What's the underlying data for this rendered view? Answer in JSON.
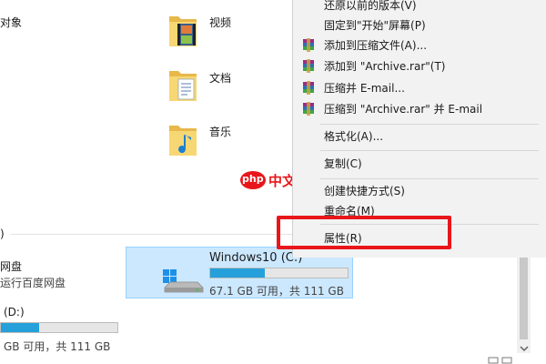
{
  "folders": [
    {
      "label": "视频",
      "icon": "video-folder-icon"
    },
    {
      "label": "文档",
      "icon": "documents-folder-icon"
    },
    {
      "label": "音乐",
      "icon": "music-folder-icon"
    }
  ],
  "left_clipped": {
    "objects_label": "对象",
    "section_caret": ")",
    "netdisk_name": "网盘",
    "netdisk_sub": "运行百度网盘",
    "drive_d_name": "(D:)",
    "drive_d_space": "GB 可用，共 111 GB",
    "drive_d_used_fraction": 0.33
  },
  "drive_c": {
    "name": "Windows10 (C:)",
    "space": "67.1 GB 可用，共 111 GB",
    "used_fraction": 0.4
  },
  "context_menu": {
    "items": [
      {
        "label": "还原以前的版本(V)",
        "icon": ""
      },
      {
        "label": "固定到\"开始\"屏幕(P)",
        "icon": ""
      },
      {
        "label": "添加到压缩文件(A)...",
        "icon": "winrar-icon"
      },
      {
        "label": "添加到 \"Archive.rar\"(T)",
        "icon": "winrar-icon"
      },
      {
        "label": "压缩并 E-mail...",
        "icon": "winrar-icon"
      },
      {
        "label": "压缩到 \"Archive.rar\" 并 E-mail",
        "icon": "winrar-icon"
      },
      {
        "label": "格式化(A)...",
        "icon": ""
      },
      {
        "label": "复制(C)",
        "icon": ""
      },
      {
        "label": "创建快捷方式(S)",
        "icon": ""
      },
      {
        "label": "重命名(M)",
        "icon": ""
      },
      {
        "label": "属性(R)",
        "icon": ""
      }
    ]
  },
  "watermark": {
    "logo_text": "php",
    "text": "中文网"
  },
  "colors": {
    "highlight_box": "#e8161b",
    "drive_bar_fill": "#26a0da",
    "selected_tile": "#cce8ff"
  }
}
